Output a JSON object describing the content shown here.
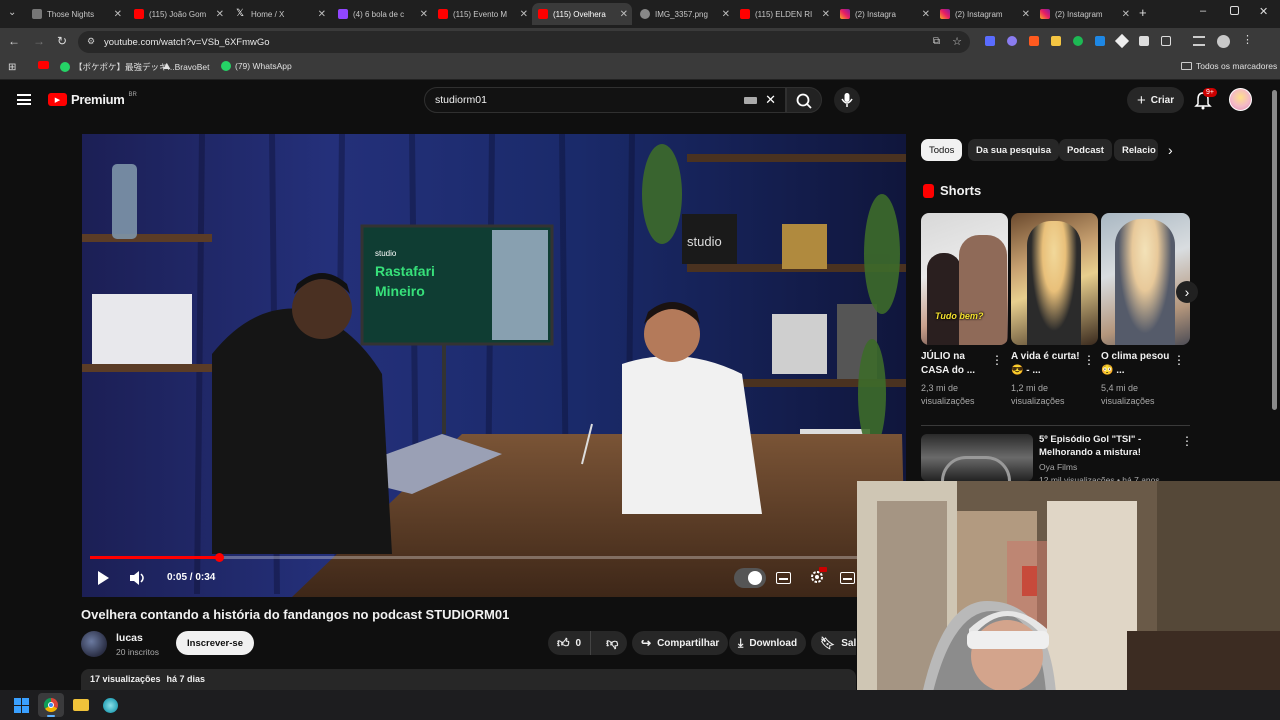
{
  "browser": {
    "tabs": [
      {
        "label": "Those Nights"
      },
      {
        "label": "(115) João Gom"
      },
      {
        "label": "Home / X"
      },
      {
        "label": "(4) 6 bola de c"
      },
      {
        "label": "(115) Evento M"
      },
      {
        "label": "(115) Ovelhera"
      },
      {
        "label": "IMG_3357.png"
      },
      {
        "label": "(115) ELDEN RI"
      },
      {
        "label": "(2) Instagra"
      },
      {
        "label": "(2) Instagram"
      },
      {
        "label": "(2) Instagram"
      }
    ],
    "url": "youtube.com/watch?v=VSb_6XFmwGo",
    "bookmarks": [
      {
        "label": ""
      },
      {
        "label": "【ポケポケ】最強デッキ..."
      },
      {
        "label": "BravoBet"
      },
      {
        "label": "(79) WhatsApp"
      }
    ],
    "all_bookmarks": "Todos os marcadores"
  },
  "youtube": {
    "logo": "Premium",
    "logo_region": "BR",
    "search_value": "studiorm01",
    "create_label": "Criar",
    "notif_badge": "9+",
    "chips": [
      "Todos",
      "Da sua pesquisa",
      "Podcast",
      "Relacio"
    ]
  },
  "video": {
    "time": "0:05 / 0:34",
    "progress": 0.16,
    "title": "Ovelhera contando a história do fandangos no podcast STUDIORM01",
    "screen_brand": "studio",
    "screen_text_1": "Rastafari",
    "screen_text_2": "Mineiro",
    "shelf_brand": "studio"
  },
  "channel": {
    "name": "lucas",
    "subs": "20 inscritos",
    "subscribe": "Inscrever-se",
    "likes": "0",
    "share": "Compartilhar",
    "download": "Download",
    "save": "Salv"
  },
  "description": {
    "views": "17 visualizações",
    "age": "há 7 dias"
  },
  "shorts": {
    "heading": "Shorts",
    "items": [
      {
        "title": "JÚLIO na CASA do ...",
        "views": "2,3 mi de visualizações",
        "caption": "Tudo bem?"
      },
      {
        "title": "A vida é curta! 😎 - ...",
        "views": "1,2 mi de visualizações"
      },
      {
        "title": "O clima pesou 😳 ...",
        "views": "5,4 mi de visualizações"
      }
    ]
  },
  "related": {
    "title": "5º Episódio Gol \"TSI\" - Melhorando a mistura!",
    "channel": "Oya Films",
    "meta": "12 mil visualizações • há 7 anos"
  },
  "colors": {
    "accent": "#ff0000",
    "bg": "#0f0f0f"
  }
}
